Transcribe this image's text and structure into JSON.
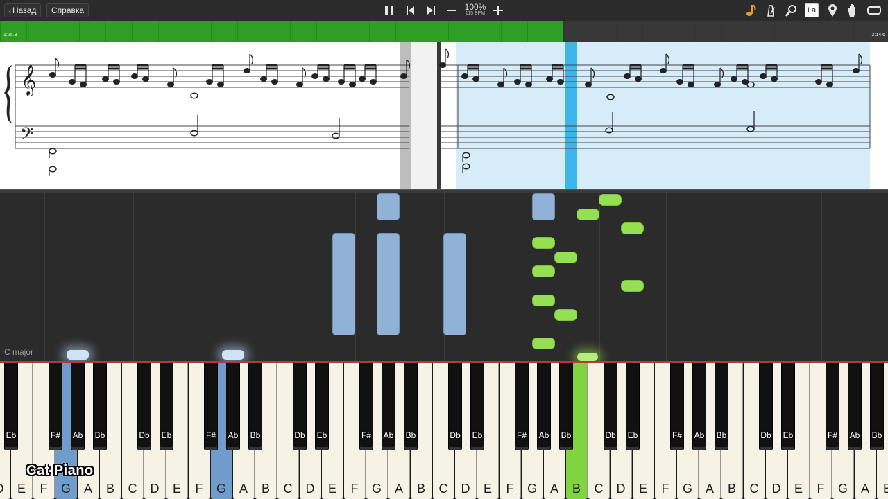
{
  "toolbar": {
    "back_label": "Назад",
    "help_label": "Справка",
    "tempo_percent": "100%",
    "tempo_bpm": "115 BPM",
    "icons": [
      "pause-icon",
      "skip-back-icon",
      "skip-forward-icon",
      "minus-icon",
      "plus-icon",
      "note-icon",
      "metronome-icon",
      "search-icon",
      "key-label-icon",
      "pin-icon",
      "hand-icon",
      "loop-icon"
    ],
    "key_label_glyph": "La"
  },
  "progress": {
    "start_time": "1:25.3",
    "end_time": "2:14.6",
    "fraction": 0.634
  },
  "roll": {
    "key_signature": "C major"
  },
  "piano": {
    "white_keys": [
      "D",
      "E",
      "F",
      "G",
      "A",
      "B",
      "C",
      "D",
      "E",
      "F",
      "G",
      "A",
      "B",
      "C",
      "D",
      "E",
      "F",
      "G",
      "A",
      "B",
      "C",
      "D",
      "E",
      "F",
      "G",
      "A",
      "B",
      "C",
      "D",
      "E",
      "F",
      "G",
      "A",
      "B",
      "C",
      "D",
      "E",
      "F",
      "G",
      "A",
      "B"
    ],
    "black_labels": [
      "Db",
      "Eb",
      "F#",
      "Ab",
      "Bb"
    ],
    "highlight_blue": [
      "G"
    ],
    "highlight_green": [
      "B"
    ]
  },
  "watermark": "Cat Piano",
  "colors": {
    "progress": "#2e9e24",
    "left_hand": "#8fb2d6",
    "right_hand": "#95e052",
    "playhead": "#3fb6ea",
    "selection": "#d6ecf8"
  }
}
